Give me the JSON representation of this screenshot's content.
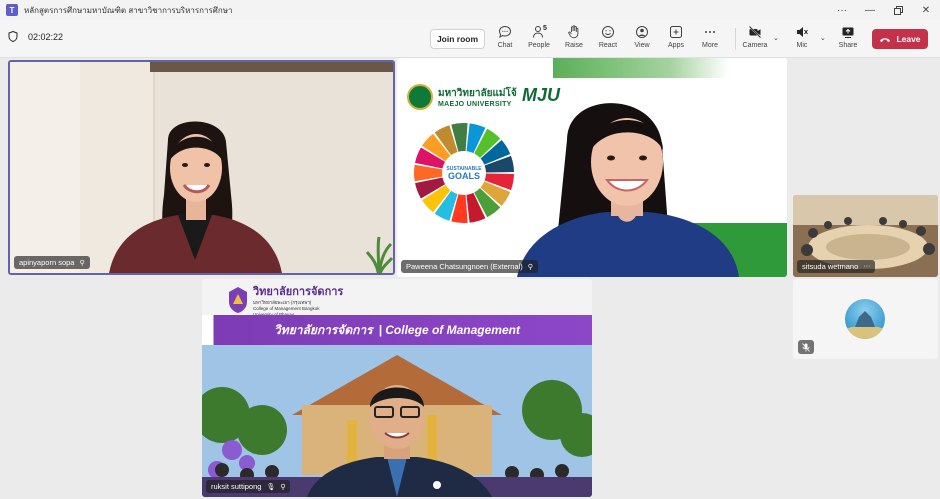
{
  "window": {
    "title": "หลักสูตรการศึกษามหาบัณฑิต สาขาวิชาการบริหารการศึกษา",
    "logo": "T",
    "controls": [
      "more-icon",
      "minimize-icon",
      "restore-icon",
      "close-icon"
    ]
  },
  "toolbar": {
    "timer": "02:02:22",
    "join_room": "Join room",
    "chat": "Chat",
    "people": "People",
    "people_count": "5",
    "raise": "Raise",
    "react": "React",
    "view": "View",
    "apps": "Apps",
    "more": "More",
    "camera": "Camera",
    "mic": "Mic",
    "share": "Share",
    "leave": "Leave"
  },
  "colors": {
    "accent": "#6264a7",
    "leave": "#c4314b",
    "purple_banner": "#7d3cb5",
    "mju_green": "#0d6b36"
  },
  "participants": [
    {
      "name": "apinyaporn sopa"
    },
    {
      "name": "Paweena Chatsungnoen (External)"
    },
    {
      "name": "sitsuda wetmano"
    },
    {
      "name": ""
    },
    {
      "name": "ruksit suttipong"
    }
  ],
  "slide_mju": {
    "uni_th": "มหาวิทยาลัยแม่โจ้",
    "uni_en": "MAEJO UNIVERSITY",
    "brand": "MJU",
    "sdg_text": "SUSTAINABLE DEVELOPMENT GOALS"
  },
  "slide_cm": {
    "logo_th": "วิทยาลัยการจัดการ",
    "logo_sub1": "มหาวิทยาลัยพะเยา (กรุงเทพฯ)",
    "logo_sub2": "College of Management Bangkok",
    "logo_sub3": "University of Phayao",
    "banner_th": "วิทยาลัยการจัดการ",
    "banner_en": "| College of Management"
  }
}
